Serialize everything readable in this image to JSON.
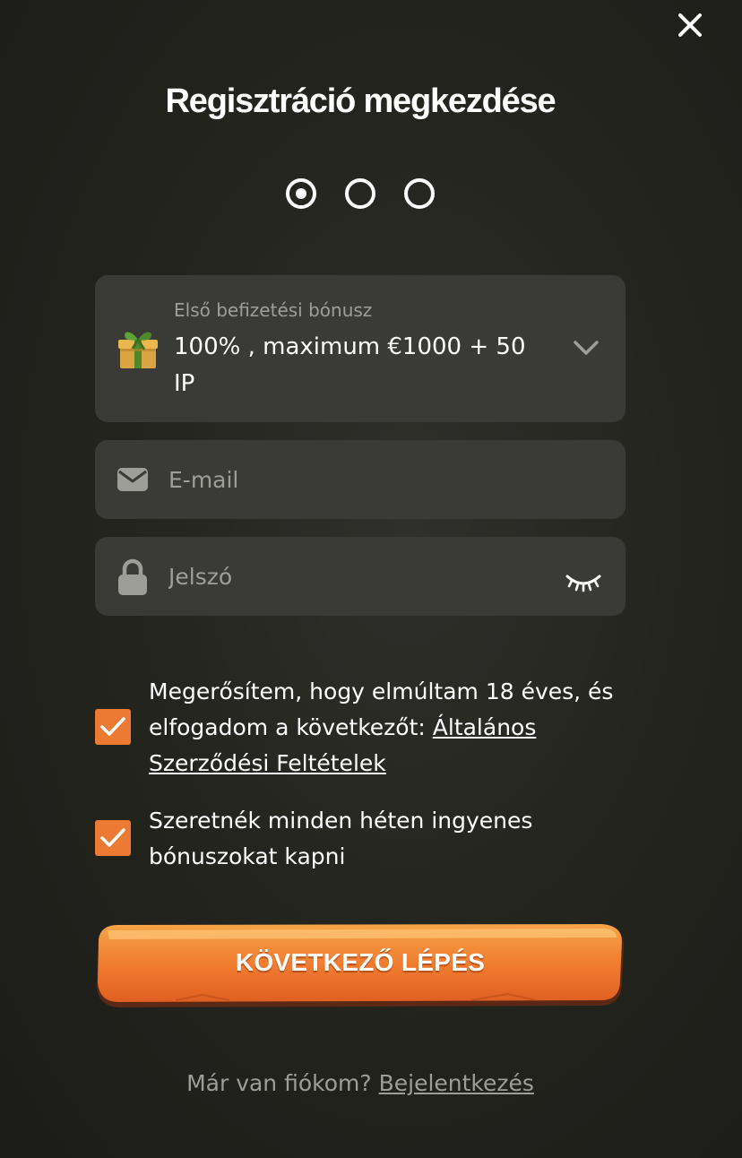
{
  "header": {
    "title": "Regisztráció megkezdése",
    "close_icon": "close-icon"
  },
  "steps": {
    "total": 3,
    "current": 1
  },
  "bonus": {
    "label": "Első befizetési bónusz",
    "value": "100% , maximum €1000 + 50 IP",
    "icon": "gift-icon",
    "dropdown_icon": "chevron-down-icon"
  },
  "email": {
    "placeholder": "E-mail",
    "icon": "envelope-icon"
  },
  "password": {
    "placeholder": "Jelszó",
    "icon": "lock-icon",
    "toggle_icon": "eye-closed-icon"
  },
  "consents": [
    {
      "checked": true,
      "text": "Megerősítem, hogy elmúltam 18 éves, és elfogadom a következőt: ",
      "link": "Általános Szerződési Feltételek"
    },
    {
      "checked": true,
      "text": "Szeretnék minden héten ingyenes bónuszokat kapni"
    }
  ],
  "cta": {
    "label": "KÖVETKEZŐ LÉPÉS"
  },
  "footer": {
    "text": "Már van fiókom? ",
    "link": "Bejelentkezés"
  },
  "colors": {
    "accent": "#ec7a32",
    "field_bg": "#3a3b36",
    "muted_text": "#9d9e98"
  }
}
